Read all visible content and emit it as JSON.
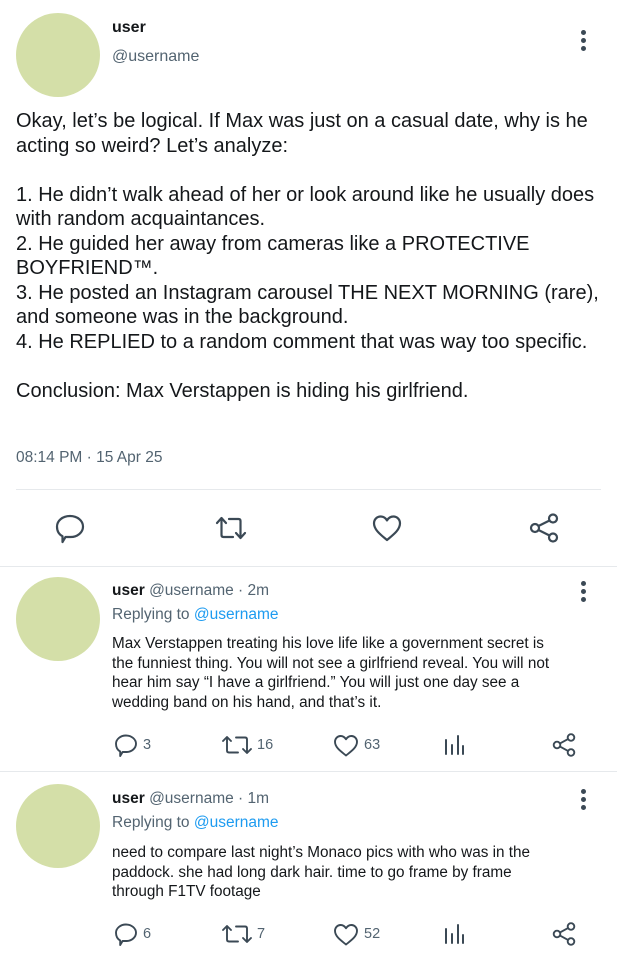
{
  "post": {
    "display_name": "user",
    "handle": "@username",
    "text_lines": [
      "Okay, let’s be logical. If Max was just on a casual date, why is he",
      "acting so weird? Let’s analyze:",
      "",
      "1. He didn’t walk ahead of her or look around like he usually does",
      "with random acquaintances.",
      "2. He guided her away from cameras like a PROTECTIVE",
      "BOYFRIEND™.",
      "3. He posted an Instagram carousel THE NEXT MORNING (rare),",
      "and someone was in the background.",
      "4. He REPLIED to a random comment that was way too specific.",
      "",
      "Conclusion: Max Verstappen is hiding his girlfriend."
    ],
    "timestamp": "08:14 PM · 15 Apr 25",
    "actions": [
      "reply-icon",
      "retweet-icon",
      "like-icon",
      "share-icon"
    ]
  },
  "replies": [
    {
      "display_name": "user",
      "handle_time": "@username · 2m",
      "replying_prefix": "Replying to",
      "replying_to": "@username",
      "text_lines": [
        "Max Verstappen treating his love life like a government secret is",
        "the funniest thing. You will not see a girlfriend reveal. You will not",
        "hear him say “I have a girlfriend.” You will just one day see a",
        "wedding band on his hand, and that’s it."
      ],
      "replies_count": "3",
      "retweets_count": "16",
      "likes_count": "63"
    },
    {
      "display_name": "user",
      "handle_time": "@username · 1m",
      "replying_prefix": "Replying to",
      "replying_to": "@username",
      "text_lines": [
        "need to compare last night’s Monaco pics with who was in the",
        "paddock. she had long dark hair. time to go frame by frame",
        "through F1TV footage"
      ],
      "replies_count": "6",
      "retweets_count": "7",
      "likes_count": "52"
    }
  ],
  "colors": {
    "avatar": "#d4dfa8",
    "secondary_text": "#536471",
    "link": "#1d9bf0",
    "icon": "#3b4955",
    "divider": "#e6e9ec"
  }
}
